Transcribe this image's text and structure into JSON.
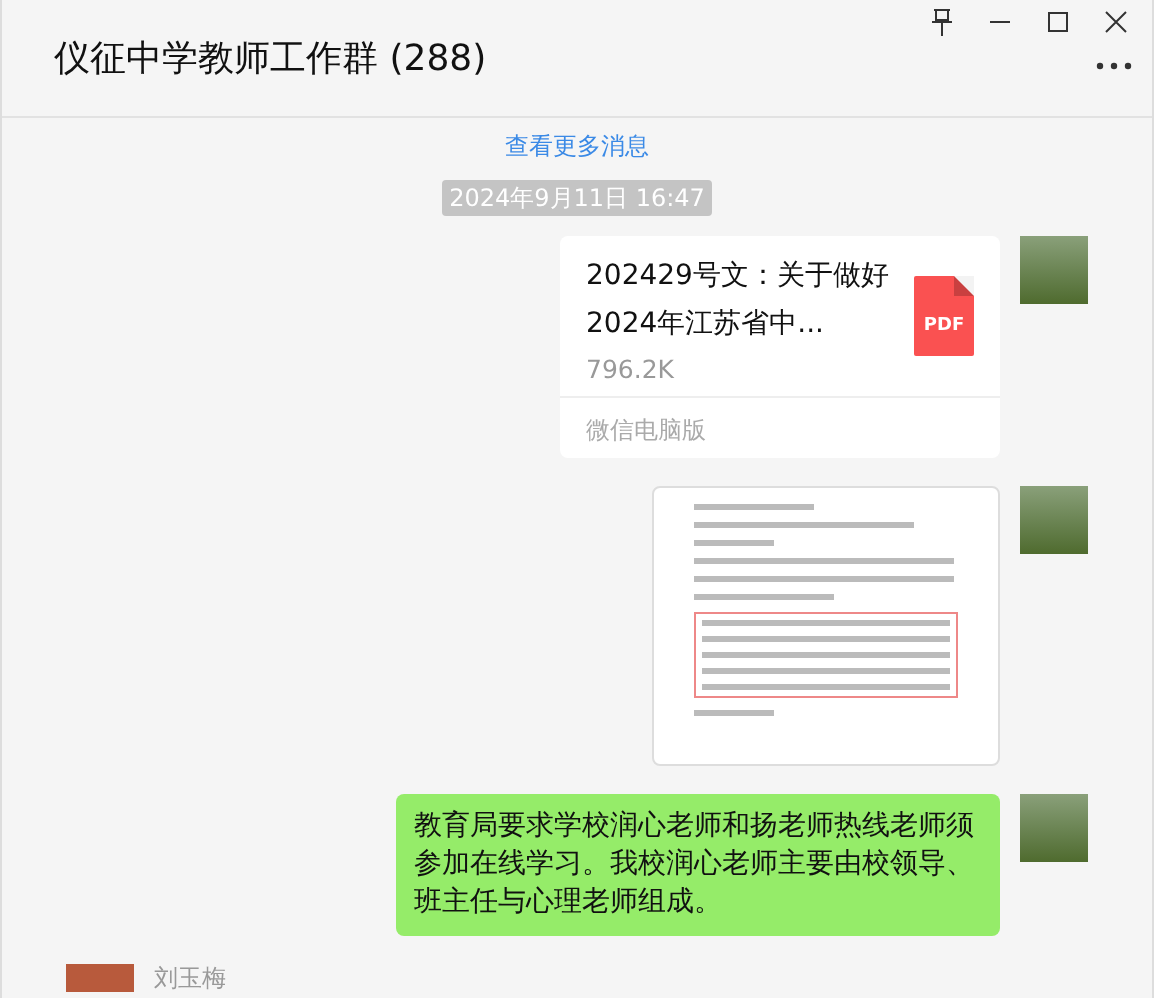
{
  "window": {
    "title": "仪征中学教师工作群 (288)"
  },
  "load_more": "查看更多消息",
  "timestamp": "2024年9月11日 16:47",
  "messages": [
    {
      "kind": "file",
      "outgoing": true,
      "file_name": "202429号文：关于做好2024年江苏省中...",
      "file_size": "796.2K",
      "file_type": "PDF",
      "source": "微信电脑版"
    },
    {
      "kind": "image",
      "outgoing": true
    },
    {
      "kind": "text",
      "outgoing": true,
      "text": "教育局要求学校润心老师和扬老师热线老师须参加在线学习。我校润心老师主要由校领导、班主任与心理老师组成。"
    },
    {
      "kind": "sender",
      "outgoing": false,
      "sender": "刘玉梅"
    }
  ]
}
